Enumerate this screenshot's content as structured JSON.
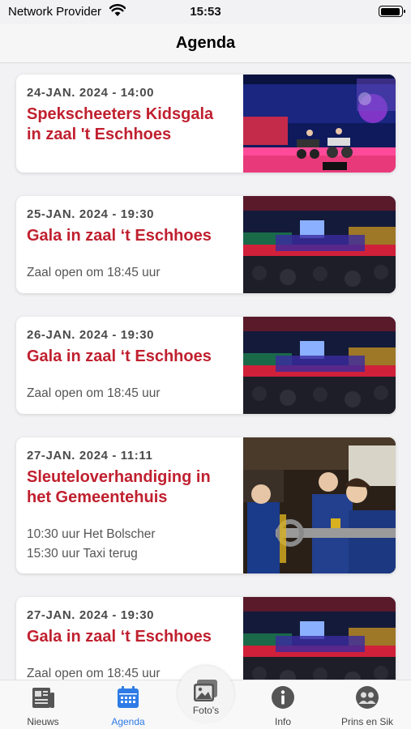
{
  "status": {
    "carrier": "Network Provider",
    "time": "15:53",
    "battery_level": 0.95
  },
  "nav": {
    "title": "Agenda"
  },
  "events": [
    {
      "date": "24-JAN. 2024 - 14:00",
      "title_lines": [
        "Spekscheeters Kidsgala",
        "in zaal 't Eschhoes"
      ],
      "sub_lines": []
    },
    {
      "date": "25-JAN. 2024 - 19:30",
      "title_lines": [
        "Gala in zaal ‘t Eschhoes"
      ],
      "sub_lines": [
        "Zaal open om 18:45 uur"
      ]
    },
    {
      "date": "26-JAN. 2024 - 19:30",
      "title_lines": [
        "Gala in zaal ‘t Eschhoes"
      ],
      "sub_lines": [
        "Zaal open om 18:45 uur"
      ]
    },
    {
      "date": "27-JAN. 2024 - 11:11",
      "title_lines": [
        "Sleuteloverhandiging in",
        "het Gemeentehuis"
      ],
      "sub_lines": [
        "10:30 uur Het Bolscher",
        "15:30 uur Taxi terug"
      ]
    },
    {
      "date": "27-JAN. 2024 - 19:30",
      "title_lines": [
        "Gala in zaal ‘t Eschhoes"
      ],
      "sub_lines": [
        "Zaal open om 18:45 uur"
      ]
    }
  ],
  "tabs": {
    "nieuws": "Nieuws",
    "agenda": "Agenda",
    "fotos": "Foto's",
    "info": "Info",
    "prins": "Prins en Sik"
  },
  "colors": {
    "accent_red": "#c0202f",
    "tab_active": "#2f7be6"
  }
}
